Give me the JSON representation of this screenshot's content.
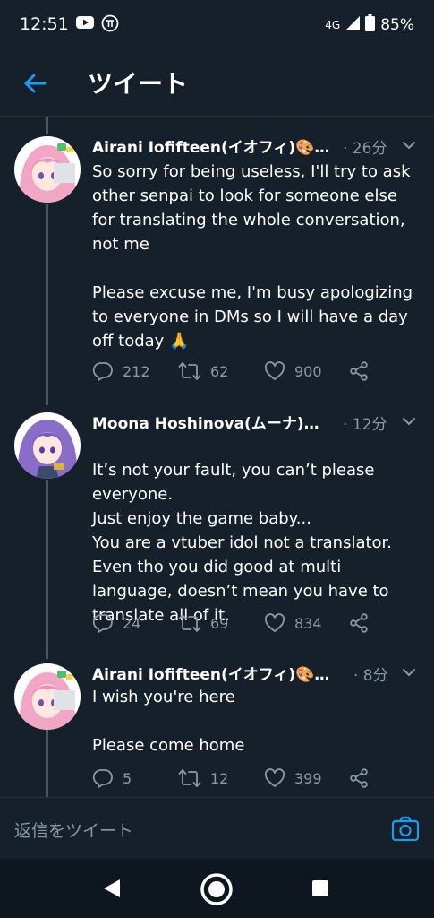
{
  "status_bar": {
    "time": "12:51",
    "network": "4G",
    "battery": "85%",
    "icons": [
      "youtube-icon",
      "pi-app-icon",
      "signal-icon",
      "battery-icon"
    ]
  },
  "header": {
    "title": "ツイート",
    "back_icon": "arrow-left-icon"
  },
  "colors": {
    "background": "#15202b",
    "accent": "#1d9bf0",
    "muted": "#8b98a5"
  },
  "tweets": [
    {
      "name": "Airani Iofifteen(イオフィ)🎨…",
      "time": "· 26分",
      "body": [
        "So sorry for being useless, I'll try to ask other senpai to look for someone else for translating the whole conversation, not me",
        "Please excuse me, I'm busy apologizing to everyone in DMs so I will have a day off today 🙏"
      ],
      "replies": "212",
      "retweets": "62",
      "likes": "900"
    },
    {
      "name": "Moona Hoshinova(ムーナ)…",
      "time": "· 12分",
      "body": [
        "It’s not your fault, you can’t please everyone.\nJust enjoy the game baby...\nYou are a vtuber idol not a translator. Even tho you did good at multi language, doesn’t mean you have to translate all of it."
      ],
      "replies": "24",
      "retweets": "69",
      "likes": "834"
    },
    {
      "name": "Airani Iofifteen(イオフィ)🎨…",
      "time": "· 8分",
      "body": [
        "I wish you're here",
        "Please come home"
      ],
      "replies": "5",
      "retweets": "12",
      "likes": "399"
    }
  ],
  "reply_bar": {
    "placeholder": "返信をツイート",
    "camera_icon": "camera-icon"
  },
  "nav": {
    "icons": [
      "nav-back-icon",
      "nav-home-icon",
      "nav-recents-icon"
    ]
  }
}
